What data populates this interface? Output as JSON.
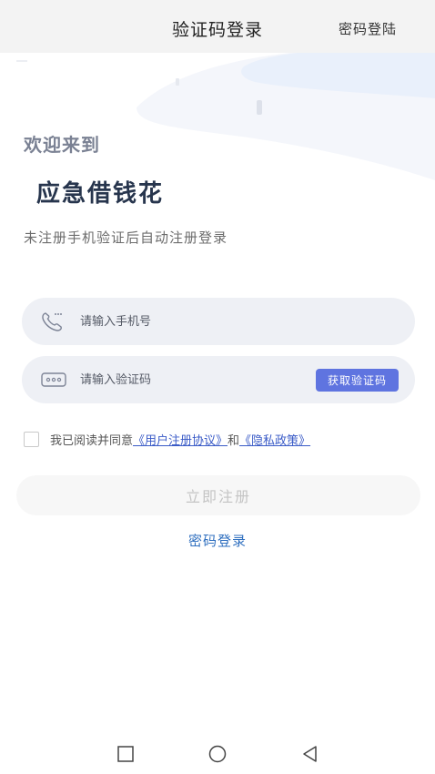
{
  "header": {
    "title": "验证码登录",
    "right_action": "密码登陆"
  },
  "welcome": {
    "greeting": "欢迎来到",
    "app_name": "应急借钱花",
    "subtitle": "未注册手机验证后自动注册登录"
  },
  "form": {
    "phone_placeholder": "请输入手机号",
    "code_placeholder": "请输入验证码",
    "get_code_label": "获取验证码",
    "phone_icon": "phone-icon",
    "code_icon": "code-icon"
  },
  "agreement": {
    "prefix": "我已阅读并同意",
    "user_agreement": "《用户注册协议》",
    "and": "和",
    "privacy_policy": "《隐私政策》",
    "checked": false
  },
  "actions": {
    "register_label": "立即注册",
    "password_login_label": "密码登录"
  },
  "navbar": {
    "icons": [
      "recent-apps-icon",
      "home-icon",
      "back-icon"
    ]
  },
  "colors": {
    "accent": "#5f74e0",
    "link": "#3a5bc7",
    "title_dark": "#27354d",
    "field_bg": "#eef0f5"
  }
}
